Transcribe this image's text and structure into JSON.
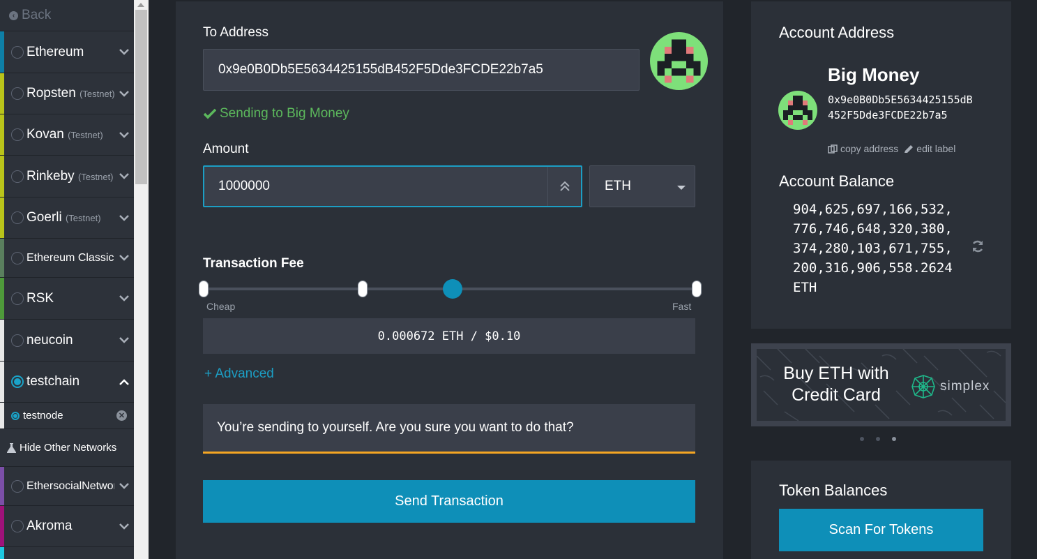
{
  "sidebar": {
    "back_label": "Back",
    "networks": [
      {
        "name": "Ethereum",
        "tag": "",
        "color": "#0e7fa6",
        "selected": false,
        "expanded": false
      },
      {
        "name": "Ropsten",
        "tag": "(Testnet)",
        "color": "#b9c41a",
        "selected": false,
        "expanded": false
      },
      {
        "name": "Kovan",
        "tag": "(Testnet)",
        "color": "#b9c41a",
        "selected": false,
        "expanded": false
      },
      {
        "name": "Rinkeby",
        "tag": "(Testnet)",
        "color": "#b9c41a",
        "selected": false,
        "expanded": false
      },
      {
        "name": "Goerli",
        "tag": "(Testnet)",
        "color": "#b9c41a",
        "selected": false,
        "expanded": false
      },
      {
        "name": "Ethereum Classic",
        "tag": "",
        "color": "#5a7f5e",
        "selected": false,
        "expanded": false
      },
      {
        "name": "RSK",
        "tag": "",
        "color": "#4e9a3a",
        "selected": false,
        "expanded": false
      },
      {
        "name": "neucoin",
        "tag": "",
        "color": "#e8e8e8",
        "selected": false,
        "expanded": false
      },
      {
        "name": "testchain",
        "tag": "",
        "color": "#e8e8e8",
        "selected": true,
        "expanded": true
      }
    ],
    "node": {
      "name": "testnode"
    },
    "hide_label": "Hide Other Networks",
    "networks_more": [
      {
        "name": "EthersocialNetwork",
        "tag": "",
        "color": "#7b4fa8"
      },
      {
        "name": "Akroma",
        "tag": "",
        "color": "#a0127a"
      }
    ],
    "extra_color": "#1ec8e0"
  },
  "form": {
    "to_label": "To Address",
    "to_value": "0x9e0B0Db5E5634425155dB452F5Dde3FCDE22b7a5",
    "sending_text": "Sending to Big Money",
    "amount_label": "Amount",
    "amount_value": "1000000",
    "unit": "ETH",
    "fee_label": "Transaction Fee",
    "fee_min_label": "Cheap",
    "fee_max_label": "Fast",
    "fee_level": 0.5,
    "fee_value": "0.000672 ETH / $0.10",
    "advanced_label": "+ Advanced",
    "warning_text": "You’re sending to yourself. Are you sure you want to do that?",
    "send_label": "Send Transaction"
  },
  "account": {
    "title": "Account Address",
    "name": "Big Money",
    "address": "0x9e0B0Db5E5634425155dB452F5Dde3FCDE22b7a5",
    "copy_label": "copy address",
    "edit_label": "edit label",
    "balance_title": "Account Balance",
    "balance": "904,625,697,166,532,776,746,648,320,380,374,280,103,671,755,200,316,906,558.2624 ETH"
  },
  "promo": {
    "text": "Buy ETH with Credit Card",
    "brand": "simplex",
    "slides": 3,
    "active_slide": 2
  },
  "tokens": {
    "title": "Token Balances",
    "scan_label": "Scan For Tokens"
  },
  "colors": {
    "accent": "#0e8fb8",
    "success": "#5cb85c",
    "warning": "#f5a623",
    "panel": "#2b3038",
    "input": "#3a3f4a"
  },
  "icons": {
    "back": "back-arrow-icon",
    "radio": "radio-icon",
    "chevron": "chevron-down-icon",
    "remove": "remove-icon",
    "flask": "flask-icon",
    "check": "check-icon",
    "increment": "double-chevron-up-icon",
    "copy": "copy-icon",
    "edit": "pencil-icon",
    "refresh": "refresh-icon"
  }
}
